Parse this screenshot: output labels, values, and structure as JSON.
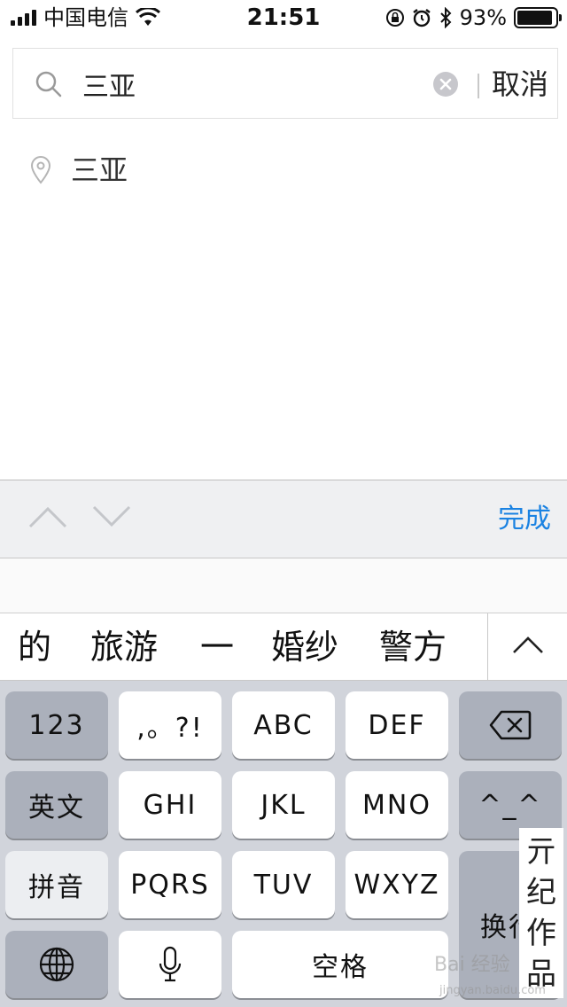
{
  "status_bar": {
    "carrier": "中国电信",
    "time": "21:51",
    "battery_percent": "93%",
    "battery_level": 0.93,
    "icons": [
      "signal-icon",
      "wifi-icon",
      "orientation-lock-icon",
      "alarm-icon",
      "bluetooth-icon",
      "battery-icon"
    ]
  },
  "search": {
    "value": "三亚",
    "cancel_label": "取消",
    "icons": [
      "search-icon",
      "clear-icon"
    ]
  },
  "results": [
    {
      "label": "三亚",
      "icon": "location-pin-icon"
    }
  ],
  "accessory": {
    "done_label": "完成",
    "icons": [
      "chevron-up-icon",
      "chevron-down-icon"
    ]
  },
  "candidates": [
    "的",
    "旅游",
    "一",
    "婚纱",
    "警方"
  ],
  "keyboard": {
    "row1": [
      "123",
      ",。?!",
      "ABC",
      "DEF"
    ],
    "row2": [
      "英文",
      "GHI",
      "JKL",
      "MNO",
      "^_^"
    ],
    "row3": [
      "拼音",
      "PQRS",
      "TUV",
      "WXYZ"
    ],
    "return_label": "换行",
    "space_label": "空格",
    "icons": [
      "delete-icon",
      "globe-icon",
      "microphone-icon"
    ]
  },
  "watermark": {
    "chars": [
      "亓",
      "纪",
      "作",
      "品"
    ],
    "baidu": "Bai 经验",
    "url": "jingyan.baidu.com"
  },
  "colors": {
    "accent": "#1a82e2",
    "keyboard_bg": "#d1d4db",
    "dark_key": "#abb0bb"
  }
}
